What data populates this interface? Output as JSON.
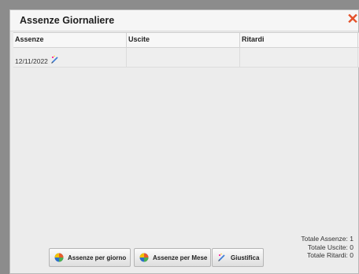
{
  "dialog": {
    "title": "Assenze Giornaliere",
    "close_icon": "close-x-icon"
  },
  "table": {
    "headers": [
      "Assenze",
      "Uscite",
      "Ritardi"
    ],
    "rows": [
      {
        "assenze": "12/11/2022",
        "uscite": "",
        "ritardi": ""
      }
    ]
  },
  "footer": {
    "btn_per_giorno": "Assenze per giorno",
    "btn_per_mese": "Assenze per Mese",
    "btn_giustifica": "Giustifica",
    "tot_assenze": "Totale Assenze: 1",
    "tot_uscite": "Totale Uscite: 0",
    "tot_ritardi": "Totale Ritardi: 0"
  },
  "colors": {
    "close": "#e4512a",
    "background": "#ececec"
  }
}
